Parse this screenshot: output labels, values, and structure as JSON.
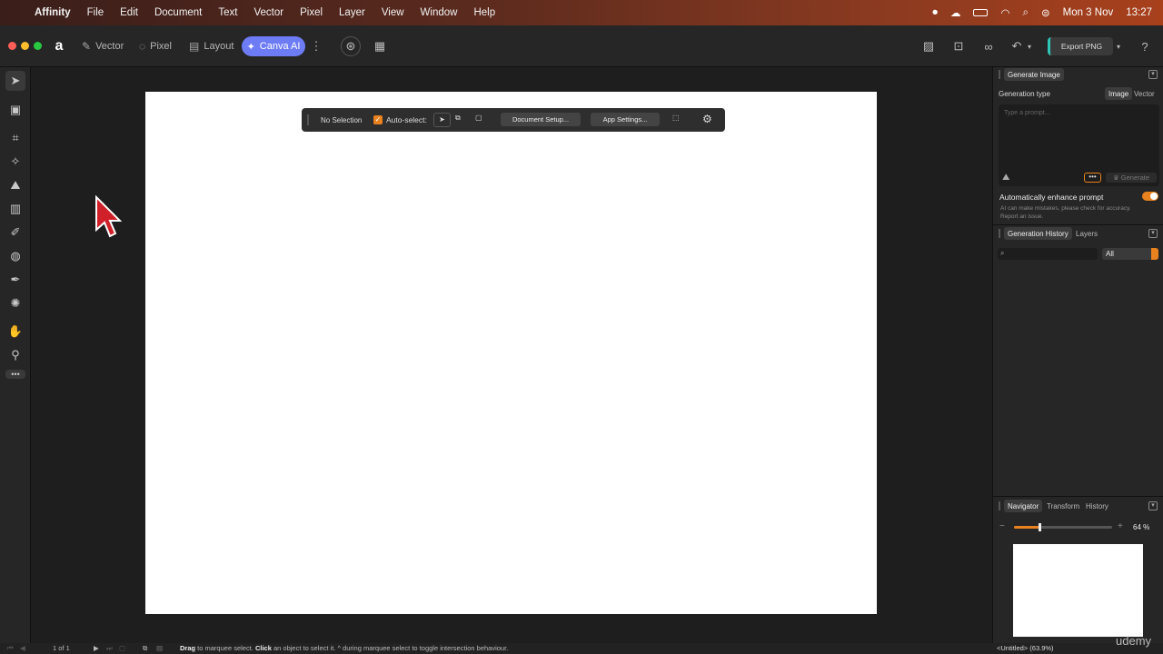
{
  "menubar": {
    "app_name": "Affinity",
    "items": [
      "File",
      "Edit",
      "Document",
      "Text",
      "Vector",
      "Pixel",
      "Layer",
      "View",
      "Window",
      "Help"
    ],
    "date": "Mon 3 Nov",
    "time": "13:27"
  },
  "toolbar": {
    "personas": [
      {
        "label": "Vector",
        "icon": "vector-persona-icon"
      },
      {
        "label": "Pixel",
        "icon": "pixel-persona-icon"
      },
      {
        "label": "Layout",
        "icon": "layout-persona-icon"
      }
    ],
    "canva_ai_label": "Canva AI",
    "export_label": "Export PNG"
  },
  "context_bar": {
    "selection_label": "No Selection",
    "auto_select_label": "Auto-select:",
    "document_setup_label": "Document Setup...",
    "app_settings_label": "App Settings..."
  },
  "generate_panel": {
    "tab_label": "Generate Image",
    "generation_type_label": "Generation type",
    "type_options": [
      "Image",
      "Vector"
    ],
    "prompt_placeholder": "Type a prompt...",
    "generate_label": "Generate",
    "enhance_label": "Automatically enhance prompt",
    "disclaimer_line1": "AI can make mistakes, please check for accuracy.",
    "disclaimer_line2": "Report an issue."
  },
  "history_panel": {
    "tabs": [
      "Generation History",
      "Layers"
    ],
    "filter_value": "All"
  },
  "navigator_panel": {
    "tabs": [
      "Navigator",
      "Transform",
      "History"
    ],
    "zoom": "64 %"
  },
  "statusbar": {
    "page_indicator": "1 of 1",
    "hint_drag": "Drag",
    "hint_1": " to marquee select. ",
    "hint_click": "Click",
    "hint_2": " an object to select it. ",
    "hint_3": "^ during marquee select to toggle intersection behaviour.",
    "doc_name": "<Untitled> (63.9%)"
  },
  "watermark": "udemy",
  "colors": {
    "accent": "#e8821e",
    "canva": "#6d7cf5",
    "panel_bg": "#262626",
    "workspace_bg": "#1e1e1e"
  }
}
